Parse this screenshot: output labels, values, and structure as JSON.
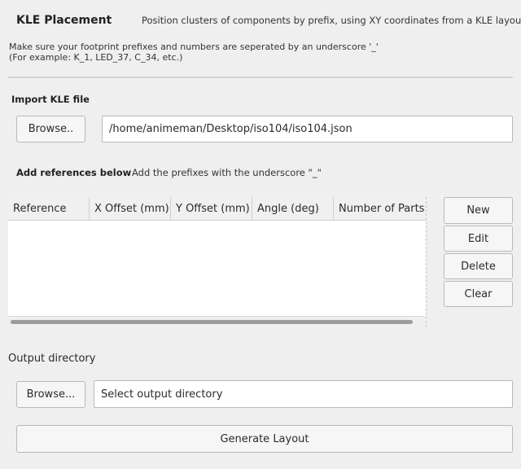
{
  "header": {
    "title": "KLE Placement",
    "subtitle": "Position clusters of components by prefix, using XY coordinates from a KLE layout"
  },
  "note": {
    "line1": "Make sure your footprint prefixes and numbers are seperated by an underscore '_'",
    "line2": "(For example: K_1, LED_37, C_34, etc.)"
  },
  "import": {
    "label": "Import KLE file",
    "browse_label": "Browse..",
    "path_value": "/home/animeman/Desktop/iso104/iso104.json"
  },
  "references": {
    "label": "Add references below",
    "hint": "Add the prefixes with the underscore \"_\"",
    "columns": [
      "Reference",
      "X Offset (mm)",
      "Y Offset (mm)",
      "Angle (deg)",
      "Number of Parts"
    ],
    "rows": [],
    "buttons": {
      "new": "New",
      "edit": "Edit",
      "delete": "Delete",
      "clear": "Clear"
    }
  },
  "output": {
    "label": "Output directory",
    "browse_label": "Browse...",
    "placeholder": "Select output directory"
  },
  "generate_label": "Generate Layout"
}
